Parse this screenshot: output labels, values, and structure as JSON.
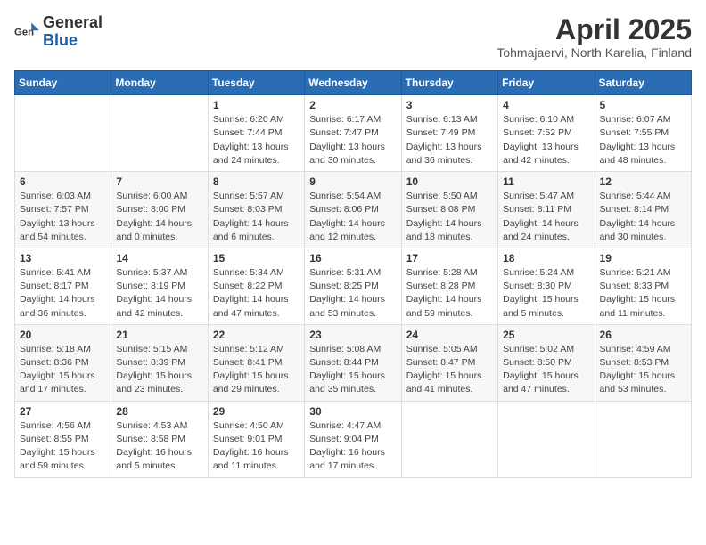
{
  "logo": {
    "general": "General",
    "blue": "Blue"
  },
  "header": {
    "month": "April 2025",
    "location": "Tohmajaervi, North Karelia, Finland"
  },
  "days_of_week": [
    "Sunday",
    "Monday",
    "Tuesday",
    "Wednesday",
    "Thursday",
    "Friday",
    "Saturday"
  ],
  "weeks": [
    [
      {
        "day": "",
        "info": ""
      },
      {
        "day": "",
        "info": ""
      },
      {
        "day": "1",
        "info": "Sunrise: 6:20 AM\nSunset: 7:44 PM\nDaylight: 13 hours and 24 minutes."
      },
      {
        "day": "2",
        "info": "Sunrise: 6:17 AM\nSunset: 7:47 PM\nDaylight: 13 hours and 30 minutes."
      },
      {
        "day": "3",
        "info": "Sunrise: 6:13 AM\nSunset: 7:49 PM\nDaylight: 13 hours and 36 minutes."
      },
      {
        "day": "4",
        "info": "Sunrise: 6:10 AM\nSunset: 7:52 PM\nDaylight: 13 hours and 42 minutes."
      },
      {
        "day": "5",
        "info": "Sunrise: 6:07 AM\nSunset: 7:55 PM\nDaylight: 13 hours and 48 minutes."
      }
    ],
    [
      {
        "day": "6",
        "info": "Sunrise: 6:03 AM\nSunset: 7:57 PM\nDaylight: 13 hours and 54 minutes."
      },
      {
        "day": "7",
        "info": "Sunrise: 6:00 AM\nSunset: 8:00 PM\nDaylight: 14 hours and 0 minutes."
      },
      {
        "day": "8",
        "info": "Sunrise: 5:57 AM\nSunset: 8:03 PM\nDaylight: 14 hours and 6 minutes."
      },
      {
        "day": "9",
        "info": "Sunrise: 5:54 AM\nSunset: 8:06 PM\nDaylight: 14 hours and 12 minutes."
      },
      {
        "day": "10",
        "info": "Sunrise: 5:50 AM\nSunset: 8:08 PM\nDaylight: 14 hours and 18 minutes."
      },
      {
        "day": "11",
        "info": "Sunrise: 5:47 AM\nSunset: 8:11 PM\nDaylight: 14 hours and 24 minutes."
      },
      {
        "day": "12",
        "info": "Sunrise: 5:44 AM\nSunset: 8:14 PM\nDaylight: 14 hours and 30 minutes."
      }
    ],
    [
      {
        "day": "13",
        "info": "Sunrise: 5:41 AM\nSunset: 8:17 PM\nDaylight: 14 hours and 36 minutes."
      },
      {
        "day": "14",
        "info": "Sunrise: 5:37 AM\nSunset: 8:19 PM\nDaylight: 14 hours and 42 minutes."
      },
      {
        "day": "15",
        "info": "Sunrise: 5:34 AM\nSunset: 8:22 PM\nDaylight: 14 hours and 47 minutes."
      },
      {
        "day": "16",
        "info": "Sunrise: 5:31 AM\nSunset: 8:25 PM\nDaylight: 14 hours and 53 minutes."
      },
      {
        "day": "17",
        "info": "Sunrise: 5:28 AM\nSunset: 8:28 PM\nDaylight: 14 hours and 59 minutes."
      },
      {
        "day": "18",
        "info": "Sunrise: 5:24 AM\nSunset: 8:30 PM\nDaylight: 15 hours and 5 minutes."
      },
      {
        "day": "19",
        "info": "Sunrise: 5:21 AM\nSunset: 8:33 PM\nDaylight: 15 hours and 11 minutes."
      }
    ],
    [
      {
        "day": "20",
        "info": "Sunrise: 5:18 AM\nSunset: 8:36 PM\nDaylight: 15 hours and 17 minutes."
      },
      {
        "day": "21",
        "info": "Sunrise: 5:15 AM\nSunset: 8:39 PM\nDaylight: 15 hours and 23 minutes."
      },
      {
        "day": "22",
        "info": "Sunrise: 5:12 AM\nSunset: 8:41 PM\nDaylight: 15 hours and 29 minutes."
      },
      {
        "day": "23",
        "info": "Sunrise: 5:08 AM\nSunset: 8:44 PM\nDaylight: 15 hours and 35 minutes."
      },
      {
        "day": "24",
        "info": "Sunrise: 5:05 AM\nSunset: 8:47 PM\nDaylight: 15 hours and 41 minutes."
      },
      {
        "day": "25",
        "info": "Sunrise: 5:02 AM\nSunset: 8:50 PM\nDaylight: 15 hours and 47 minutes."
      },
      {
        "day": "26",
        "info": "Sunrise: 4:59 AM\nSunset: 8:53 PM\nDaylight: 15 hours and 53 minutes."
      }
    ],
    [
      {
        "day": "27",
        "info": "Sunrise: 4:56 AM\nSunset: 8:55 PM\nDaylight: 15 hours and 59 minutes."
      },
      {
        "day": "28",
        "info": "Sunrise: 4:53 AM\nSunset: 8:58 PM\nDaylight: 16 hours and 5 minutes."
      },
      {
        "day": "29",
        "info": "Sunrise: 4:50 AM\nSunset: 9:01 PM\nDaylight: 16 hours and 11 minutes."
      },
      {
        "day": "30",
        "info": "Sunrise: 4:47 AM\nSunset: 9:04 PM\nDaylight: 16 hours and 17 minutes."
      },
      {
        "day": "",
        "info": ""
      },
      {
        "day": "",
        "info": ""
      },
      {
        "day": "",
        "info": ""
      }
    ]
  ]
}
